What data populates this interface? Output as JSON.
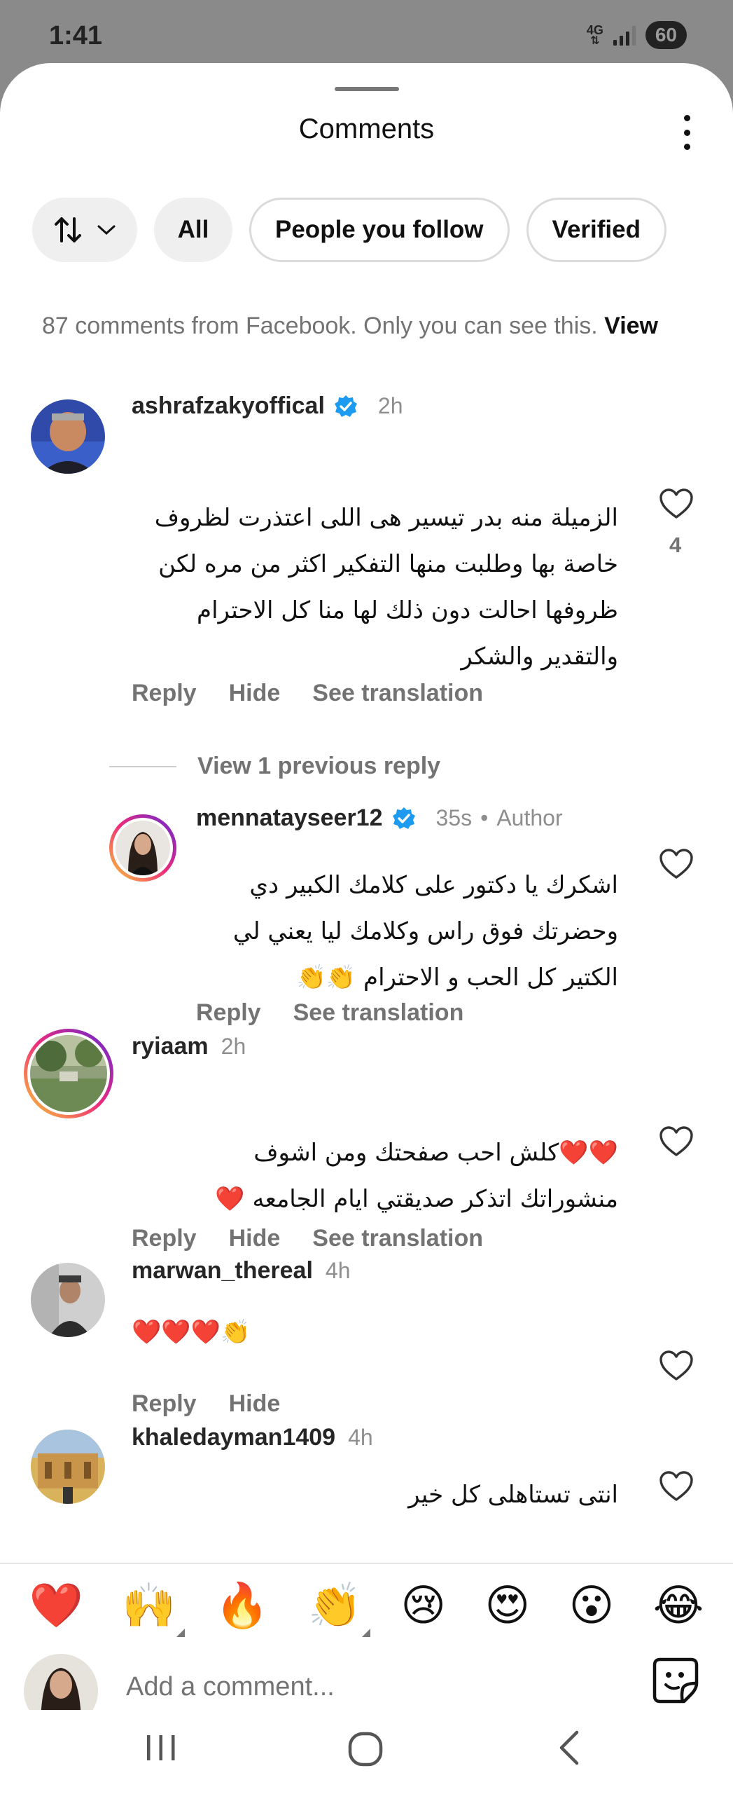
{
  "status": {
    "time": "1:41",
    "network_top": "4G",
    "battery": "60"
  },
  "sheet": {
    "title": "Comments"
  },
  "filters": {
    "all": "All",
    "following": "People you follow",
    "verified": "Verified"
  },
  "facebook_note": {
    "text": "87 comments from Facebook. Only you can see this.",
    "link": "View"
  },
  "comments": [
    {
      "username": "ashrafzakyoffical",
      "time": "2h",
      "verified": true,
      "lines": [
        "الزميلة منه بدر تيسير هى اللى اعتذرت لظروف",
        "خاصة بها وطلبت منها التفكير اكثر من مره لكن",
        "ظروفها احالت دون ذلك لها منا كل الاحترام",
        "والتقدير والشكر"
      ],
      "reply": "Reply",
      "hide": "Hide",
      "translate": "See translation",
      "likes": "4"
    },
    {
      "username": "mennatayseer12",
      "time": "35s",
      "author_tag": "Author",
      "verified": true,
      "lines": [
        "اشكرك يا دكتور على كلامك الكبير دي",
        "وحضرتك فوق راس وكلامك ليا يعني لي",
        "الكتير كل الحب و الاحترام 👏👏"
      ],
      "reply": "Reply",
      "translate": "See translation"
    },
    {
      "username": "ryiaam",
      "time": "2h",
      "lines": [
        "❤️❤️كلش احب صفحتك ومن اشوف",
        "منشوراتك اتذكر صديقتي ايام الجامعه ❤️"
      ],
      "reply": "Reply",
      "hide": "Hide",
      "translate": "See translation"
    },
    {
      "username": "marwan_thereal",
      "time": "4h",
      "lines": [
        "❤️❤️❤️👏"
      ],
      "reply": "Reply",
      "hide": "Hide"
    },
    {
      "username": "khaledayman1409",
      "time": "4h",
      "lines": [
        "انتى تستاهلى كل خير"
      ]
    }
  ],
  "view_replies": "View 1 previous reply",
  "reactions": [
    "❤️",
    "🙌",
    "🔥",
    "👏",
    "😢",
    "😍",
    "😮",
    "😂"
  ],
  "composer": {
    "placeholder": "Add a comment..."
  },
  "colors": {
    "verified_blue": "#1d9bf0",
    "secondary_text": "#737373",
    "chip_bg": "#efefef"
  }
}
